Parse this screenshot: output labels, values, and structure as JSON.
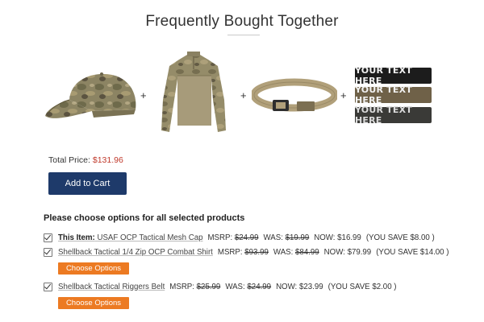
{
  "title": "Frequently Bought Together",
  "products_strip": {
    "items": [
      {
        "name": "USAF OCP Tactical Mesh Cap",
        "icon": "cap-image"
      },
      {
        "name": "Shellback Tactical 1/4 Zip OCP Combat Shirt",
        "icon": "shirt-image"
      },
      {
        "name": "Shellback Tactical Riggers Belt",
        "icon": "belt-image"
      },
      {
        "name": "Name tape patches",
        "icon": "patch-image"
      }
    ],
    "plus": "+",
    "patch_text": "YOUR TEXT HERE",
    "patch_colors": [
      "#1c1c1c",
      "#6f6148",
      "#3a3a37"
    ],
    "patch_text_colors": [
      "#f2f2f2",
      "#f2f2f2",
      "#dcdcdc"
    ]
  },
  "total": {
    "label": "Total Price:",
    "value": "$131.96",
    "value_color": "#c0392b"
  },
  "add_to_cart": "Add to Cart",
  "options_heading": "Please choose options for all selected products",
  "rows": [
    {
      "checked": true,
      "prefix": "This Item:",
      "name": "USAF OCP Tactical Mesh Cap",
      "msrp_label": "MSRP:",
      "msrp": "$24.99",
      "was_label": "WAS:",
      "was": "$19.99",
      "now_label": "NOW:",
      "now": "$16.99",
      "save": "(YOU SAVE $8.00 )",
      "choose": ""
    },
    {
      "checked": true,
      "prefix": "",
      "name": "Shellback Tactical 1/4 Zip OCP Combat Shirt",
      "msrp_label": "MSRP:",
      "msrp": "$93.99",
      "was_label": "WAS:",
      "was": "$84.99",
      "now_label": "NOW:",
      "now": "$79.99",
      "save": "(YOU SAVE $14.00 )",
      "choose": "Choose Options"
    },
    {
      "checked": true,
      "prefix": "",
      "name": "Shellback Tactical Riggers Belt",
      "msrp_label": "MSRP:",
      "msrp": "$25.99",
      "was_label": "WAS:",
      "was": "$24.99",
      "now_label": "NOW:",
      "now": "$23.99",
      "save": "(YOU SAVE $2.00 )",
      "choose": "Choose Options"
    }
  ],
  "colors": {
    "cart_button": "#1e3a6a",
    "choose_button": "#ec7a22"
  }
}
